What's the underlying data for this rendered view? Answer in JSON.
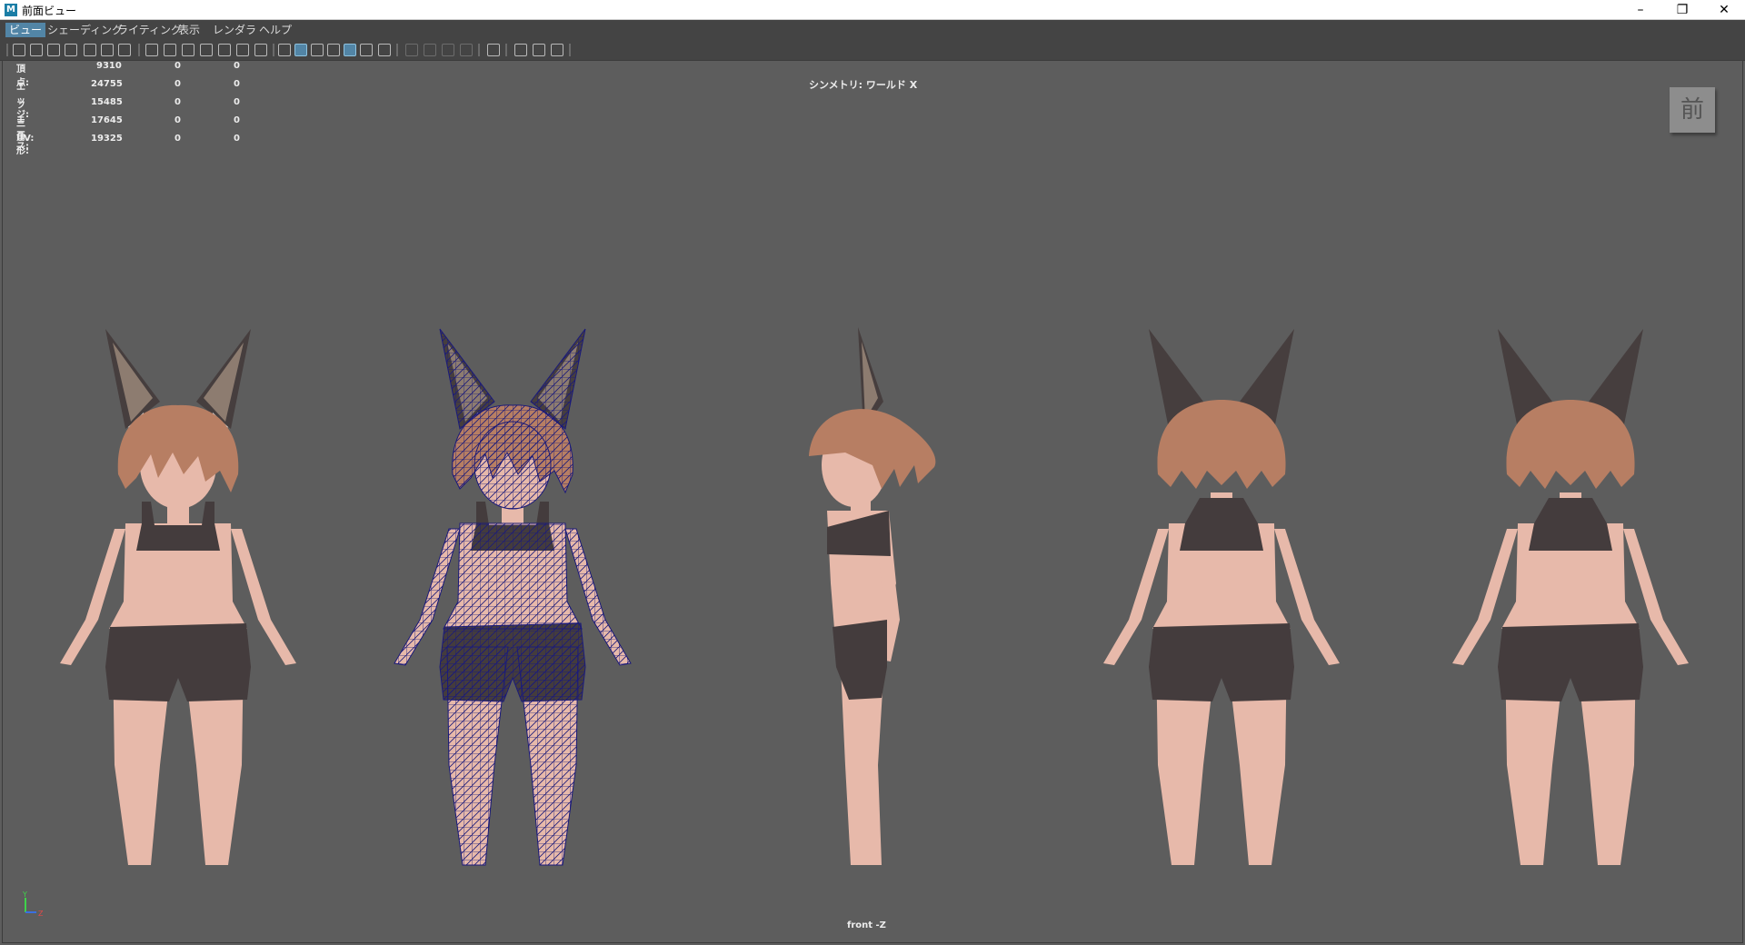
{
  "window": {
    "title": "前面ビュー",
    "min": "–",
    "restore": "❐",
    "close": "✕"
  },
  "menu": [
    "ビュー",
    "シェーディング",
    "ライティング",
    "表示",
    "レンダラ",
    "ヘルプ"
  ],
  "hud": {
    "rows": [
      {
        "label": "頂点:",
        "a": "9310",
        "b": "0",
        "c": "0"
      },
      {
        "label": "エッジ:",
        "a": "24755",
        "b": "0",
        "c": "0"
      },
      {
        "label": "フェース:",
        "a": "15485",
        "b": "0",
        "c": "0"
      },
      {
        "label": "三角形:",
        "a": "17645",
        "b": "0",
        "c": "0"
      },
      {
        "label": "UV:",
        "a": "19325",
        "b": "0",
        "c": "0"
      }
    ],
    "symmetry": "シンメトリ: ワールド X",
    "viewcube": "前",
    "camera": "front -Z",
    "axis_y": "Y",
    "axis_z": "Z"
  },
  "colors": {
    "skin": "#e7b9aa",
    "hair": "#b77e63",
    "cloth": "#443c3d",
    "ear_outer": "#463e3e",
    "ear_inner": "#8d7c70",
    "wire": "#1a1a7a",
    "accent": "#5285a6"
  },
  "figures": [
    "front-shaded",
    "front-wireframe",
    "side",
    "back-quarter",
    "back"
  ]
}
